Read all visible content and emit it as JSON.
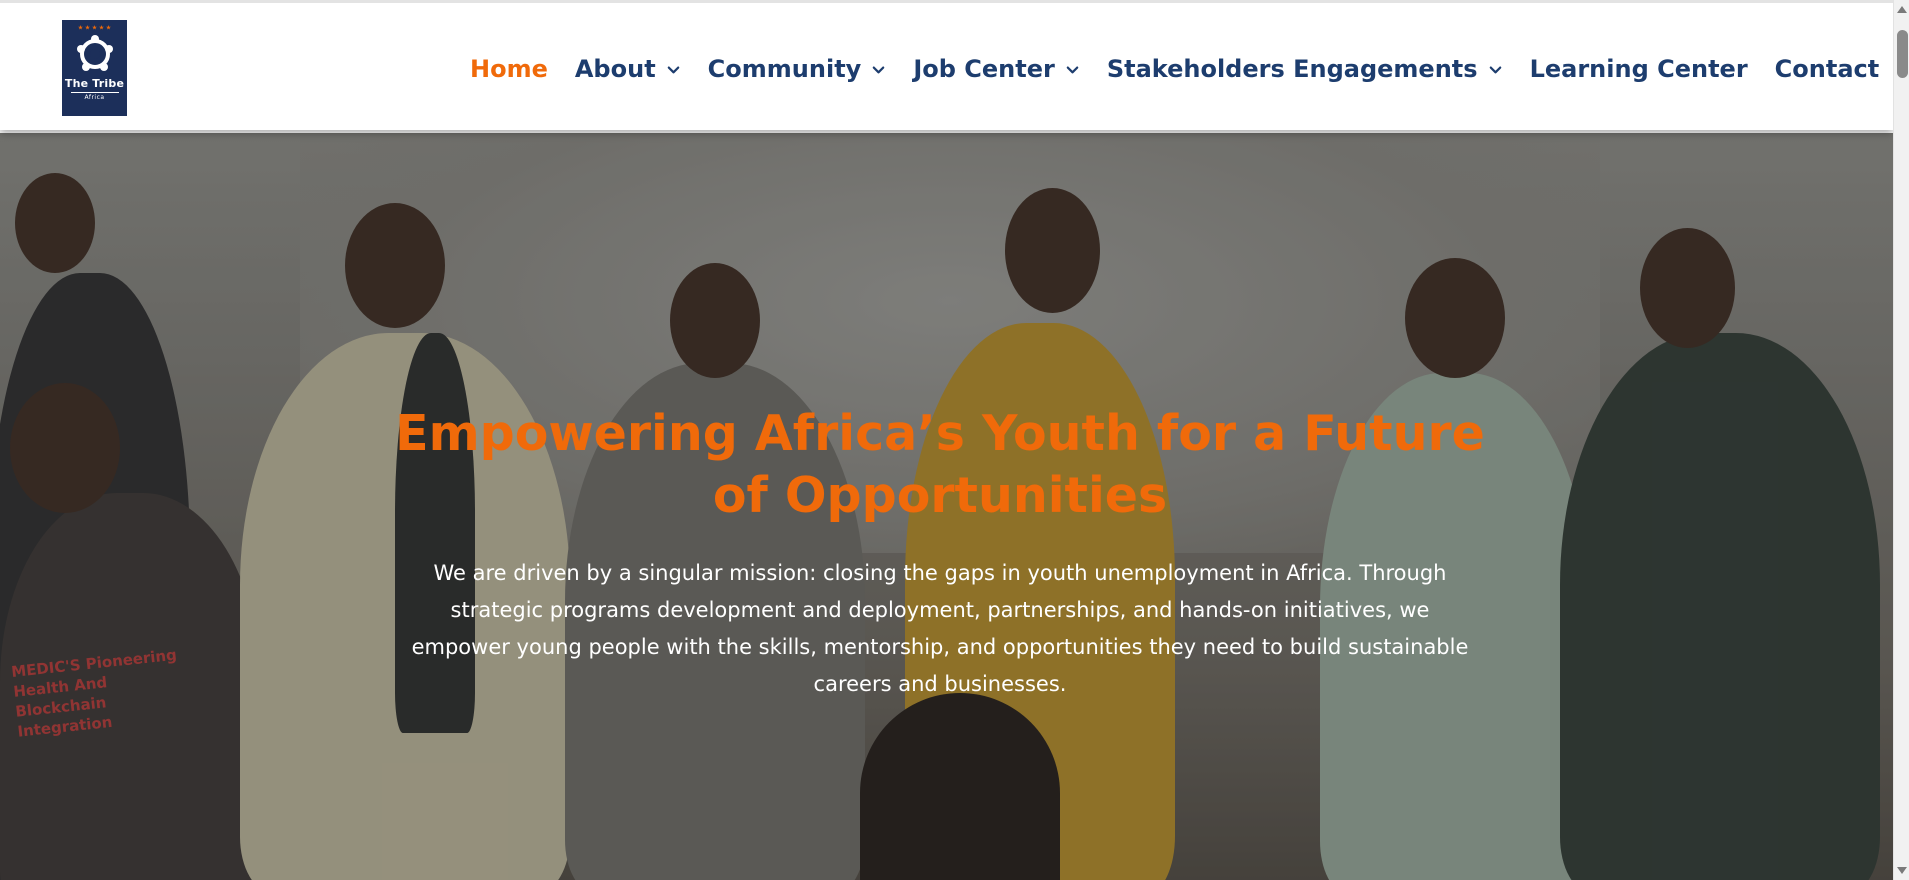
{
  "brand": {
    "logo_name": "The Tribe",
    "logo_sub": "Africa",
    "colors": {
      "navy": "#1c2f5a",
      "orange": "#f06a0a",
      "nav_text": "#1d3d6e"
    }
  },
  "nav": {
    "items": [
      {
        "label": "Home",
        "active": true,
        "dropdown": false
      },
      {
        "label": "About",
        "active": false,
        "dropdown": true
      },
      {
        "label": "Community",
        "active": false,
        "dropdown": true
      },
      {
        "label": "Job Center",
        "active": false,
        "dropdown": true
      },
      {
        "label": "Stakeholders Engagements",
        "active": false,
        "dropdown": true
      },
      {
        "label": "Learning Center",
        "active": false,
        "dropdown": false
      },
      {
        "label": "Contact",
        "active": false,
        "dropdown": false
      }
    ],
    "dropdown_icon": "chevron-down-icon"
  },
  "hero": {
    "title": "Empowering Africa’s Youth for a Future of Opportunities",
    "text": "We are driven by a singular mission: closing the gaps in youth unemployment in Africa. Through strategic programs development and deployment, partnerships, and hands-on initiatives, we empower young people with the skills, mentorship, and opportunities they need to build sustainable careers and businesses.",
    "shirt_print": "MEDIC'S Pioneering Health And Blockchain Integration"
  }
}
